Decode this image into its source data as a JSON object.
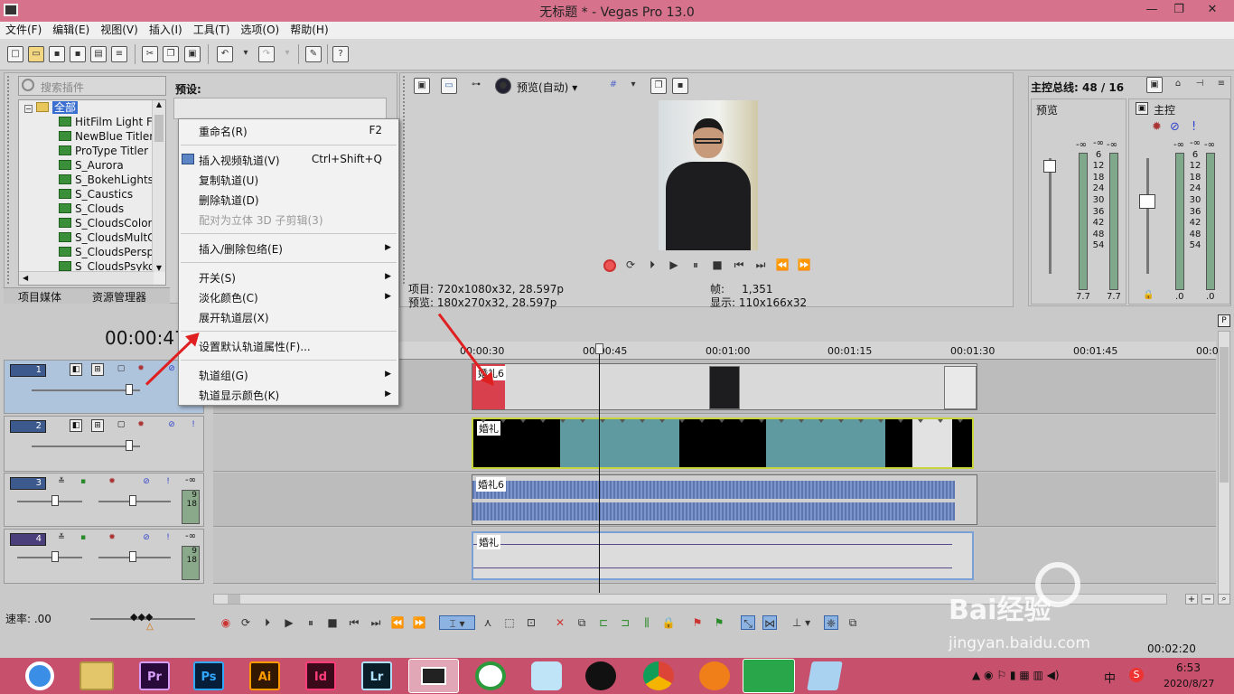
{
  "window": {
    "title": "无标题 * - Vegas Pro 13.0",
    "minimize_label": "—",
    "maximize_label": "❐",
    "close_label": "✕"
  },
  "menubar": {
    "items": [
      "文件(F)",
      "编辑(E)",
      "视图(V)",
      "插入(I)",
      "工具(T)",
      "选项(O)",
      "帮助(H)"
    ]
  },
  "plugins": {
    "search_placeholder": "搜索插件",
    "preset_label": "预设:",
    "root_label": "全部",
    "items": [
      "HitFilm Light Fla",
      "NewBlue Titler F",
      "ProType Titler",
      "S_Aurora",
      "S_BokehLights",
      "S_Caustics",
      "S_Clouds",
      "S_CloudsColorS",
      "S_CloudsMultCo",
      "S_CloudsPerspe",
      "S_CloudsPsyko"
    ],
    "tabs": [
      "项目媒体",
      "资源管理器"
    ]
  },
  "context_menu": {
    "rename": "重命名(R)",
    "rename_shortcut": "F2",
    "insert_video_track": "插入视频轨道(V)",
    "insert_video_track_shortcut": "Ctrl+Shift+Q",
    "duplicate_track": "复制轨道(U)",
    "delete_track": "删除轨道(D)",
    "pair_3d": "配对为立体 3D 子剪辑(3)",
    "insert_remove_envelope": "插入/删除包络(E)",
    "switches": "开关(S)",
    "fade_colors": "淡化颜色(C)",
    "expand_track_layers": "展开轨道层(X)",
    "default_track_properties": "设置默认轨道属性(F)...",
    "track_group": "轨道组(G)",
    "track_display_color": "轨道显示颜色(K)"
  },
  "preview": {
    "mode_label": "预览(自动)",
    "project_label": "项目:",
    "project_value": "720x1080x32, 28.597p",
    "preview_label": "预览:",
    "preview_value": "180x270x32, 28.597p",
    "frame_label": "帧:",
    "frame_value": "1,351",
    "display_label": "显示:",
    "display_value": "110x166x32"
  },
  "mixer": {
    "title": "主控总线: 48 / 16",
    "preview_label": "预览",
    "master_label": "主控",
    "meter_top": "-∞",
    "scale": [
      "6",
      "12",
      "18",
      "24",
      "30",
      "36",
      "42",
      "48",
      "54"
    ],
    "left_peak": "7.7",
    "right_peak": ".0"
  },
  "timeline": {
    "timecode": "00:00:47",
    "rate_label": "速率: .00",
    "ruler": [
      "00:00:30",
      "00:00:45",
      "00:01:00",
      "00:01:15",
      "00:01:30",
      "00:01:45",
      "00:0"
    ],
    "tracks": [
      {
        "num": "1",
        "clip_label": "婚礼6"
      },
      {
        "num": "2",
        "clip_label": "婚礼"
      },
      {
        "num": "3",
        "clip_label": "婚礼6",
        "db_top": "-∞",
        "db_a": "9",
        "db_b": "18"
      },
      {
        "num": "4",
        "clip_label": "婚礼",
        "db_top": "-∞",
        "db_a": "9",
        "db_b": "18"
      }
    ],
    "end_time": "00:02:20"
  },
  "taskbar": {
    "apps": [
      "Pr",
      "Ps",
      "Ai",
      "Id",
      "Lr"
    ],
    "time": "6:53",
    "date": "2020/8/27",
    "ime": "中"
  },
  "watermark": {
    "brand": "Bai经验",
    "url": "jingyan.baidu.com"
  }
}
